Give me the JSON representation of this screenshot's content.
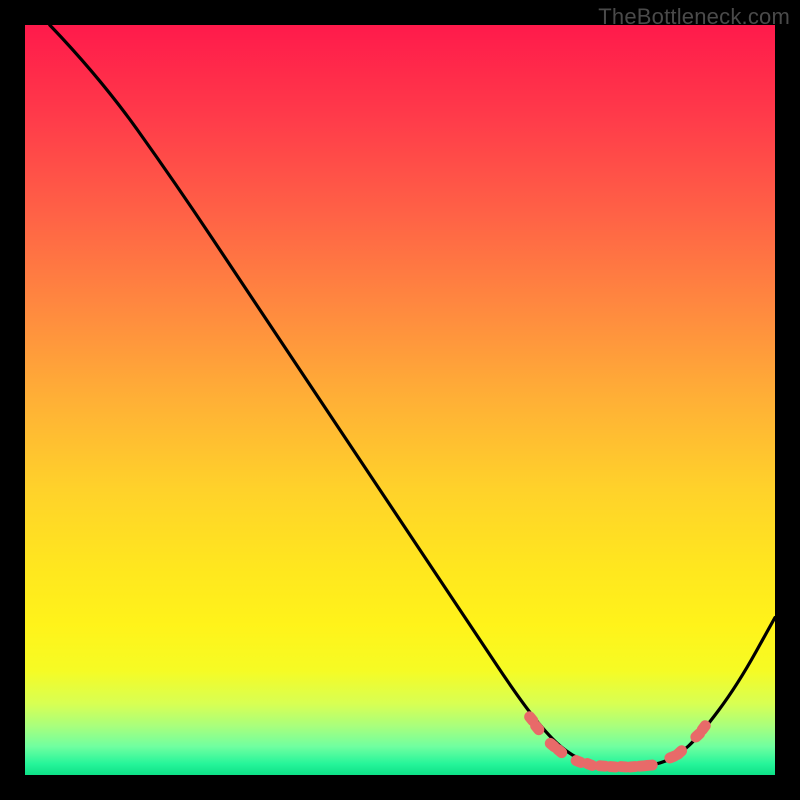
{
  "watermark": "TheBottleneck.com",
  "chart_data": {
    "type": "line",
    "title": "",
    "xlabel": "",
    "ylabel": "",
    "xlim": [
      0,
      100
    ],
    "ylim": [
      0,
      100
    ],
    "curve": [
      {
        "x": 3.3,
        "y": 100
      },
      {
        "x": 10,
        "y": 93
      },
      {
        "x": 20,
        "y": 79
      },
      {
        "x": 30,
        "y": 64
      },
      {
        "x": 40,
        "y": 49
      },
      {
        "x": 50,
        "y": 34
      },
      {
        "x": 60,
        "y": 19
      },
      {
        "x": 66,
        "y": 10
      },
      {
        "x": 70,
        "y": 5
      },
      {
        "x": 73,
        "y": 2.5
      },
      {
        "x": 76,
        "y": 1.3
      },
      {
        "x": 80,
        "y": 1.0
      },
      {
        "x": 84,
        "y": 1.3
      },
      {
        "x": 87,
        "y": 2.5
      },
      {
        "x": 90,
        "y": 5.3
      },
      {
        "x": 95,
        "y": 12
      },
      {
        "x": 100,
        "y": 21
      }
    ],
    "markers": [
      {
        "x": 67.5,
        "y": 7.5
      },
      {
        "x": 68.3,
        "y": 6.3
      },
      {
        "x": 70.3,
        "y": 4.0
      },
      {
        "x": 71.3,
        "y": 3.2
      },
      {
        "x": 73.8,
        "y": 1.8
      },
      {
        "x": 75.3,
        "y": 1.4
      },
      {
        "x": 77.0,
        "y": 1.2
      },
      {
        "x": 78.4,
        "y": 1.1
      },
      {
        "x": 79.8,
        "y": 1.1
      },
      {
        "x": 81.0,
        "y": 1.1
      },
      {
        "x": 82.3,
        "y": 1.2
      },
      {
        "x": 83.3,
        "y": 1.3
      },
      {
        "x": 86.3,
        "y": 2.4
      },
      {
        "x": 87.3,
        "y": 3.0
      },
      {
        "x": 89.7,
        "y": 5.3
      },
      {
        "x": 90.5,
        "y": 6.3
      }
    ],
    "gradient_stops": [
      {
        "offset": 0.0,
        "color": "#ff1a4b"
      },
      {
        "offset": 0.12,
        "color": "#ff3a4a"
      },
      {
        "offset": 0.25,
        "color": "#ff6146"
      },
      {
        "offset": 0.38,
        "color": "#ff8a3f"
      },
      {
        "offset": 0.5,
        "color": "#ffb036"
      },
      {
        "offset": 0.62,
        "color": "#ffd22a"
      },
      {
        "offset": 0.72,
        "color": "#ffe61f"
      },
      {
        "offset": 0.8,
        "color": "#fff31a"
      },
      {
        "offset": 0.86,
        "color": "#f6fb24"
      },
      {
        "offset": 0.905,
        "color": "#d8ff53"
      },
      {
        "offset": 0.935,
        "color": "#a8ff7d"
      },
      {
        "offset": 0.962,
        "color": "#70ffa0"
      },
      {
        "offset": 0.985,
        "color": "#26f59a"
      },
      {
        "offset": 1.0,
        "color": "#0de187"
      }
    ],
    "marker_color": "#e86a69",
    "curve_color": "#000000"
  }
}
